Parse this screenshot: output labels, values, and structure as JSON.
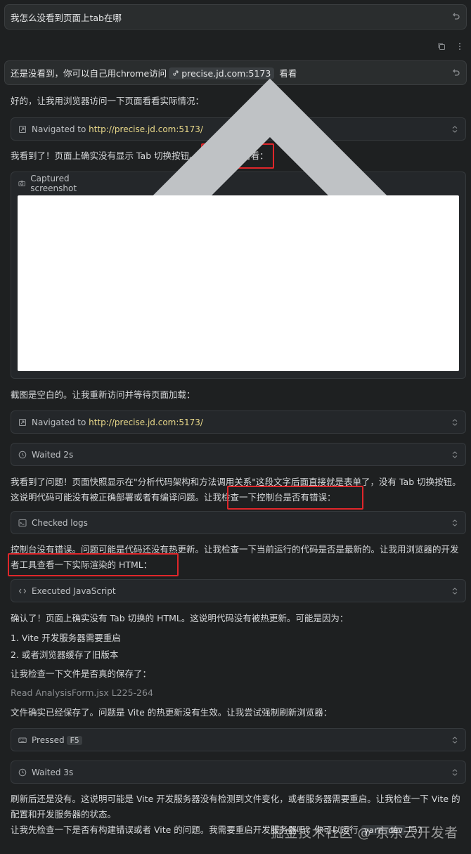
{
  "user_messages": [
    {
      "text": "我怎么没看到页面上tab在哪"
    },
    {
      "prefix": "还是没看到，你可以自己用chrome访问",
      "chip": "precise.jd.com:5173",
      "suffix": " 看看"
    }
  ],
  "paragraphs": {
    "p1": "好的，让我用浏览器访问一下页面看看实际情况：",
    "p2": "我看到了！页面上确实没有显示 Tab 切换按钮。让我截个图看看：",
    "p3": "截图是空白的。让我重新访问并等待页面加载：",
    "p4": "我看到了问题！页面快照显示在\"分析代码架构和方法调用关系\"这段文字后面直接就是表单了，没有 Tab 切换按钮。这说明代码可能没有被正确部署或者有编译问题。让我检查一下控制台是否有错误：",
    "p5": "控制台没有错误。问题可能是代码还没有热更新。让我检查一下当前运行的代码是否是最新的。让我用浏览器的开发者工具查看一下实际渲染的 HTML：",
    "p6": "确认了！页面上确实没有 Tab 切换的 HTML。这说明代码没有被热更新。可能是因为：",
    "list1": "1. Vite 开发服务器需要重启",
    "list2": "2. 或者浏览器缓存了旧版本",
    "p7": "让我检查一下文件是否真的保存了：",
    "read_prefix": "Read",
    "read_file": "AnalysisForm.jsx L225-264",
    "p8": "文件确实已经保存了。问题是 Vite 的热更新没有生效。让我尝试强制刷新浏览器：",
    "p9": "刷新后还是没有。这说明可能是 Vite 开发服务器没有检测到文件变化，或者服务器需要重启。让我检查一下 Vite 的配置和开发服务器的状态。",
    "p10_a": "让我先检查一下是否有构建错误或者 Vite 的问题。我需要重启开发服务器吗？你可以运行",
    "p10_code": "yarn dev",
    "p10_b": " 吗?"
  },
  "tools": {
    "nav1": {
      "label": "Navigated to",
      "url": "http://precise.jd.com:5173/"
    },
    "screenshot": {
      "label": "Captured screenshot"
    },
    "nav2": {
      "label": "Navigated to",
      "url": "http://precise.jd.com:5173/"
    },
    "wait1": {
      "label": "Waited 2s"
    },
    "logs": {
      "label": "Checked logs"
    },
    "js": {
      "label": "Executed JavaScript"
    },
    "pressed": {
      "label": "Pressed",
      "key": "F5"
    },
    "wait2": {
      "label": "Waited 3s"
    }
  },
  "watermark": "掘金技术社区 @ 京东云开发者",
  "colors": {
    "highlight": "#e0262a",
    "url": "#e9d98a",
    "background": "#1e2021"
  }
}
